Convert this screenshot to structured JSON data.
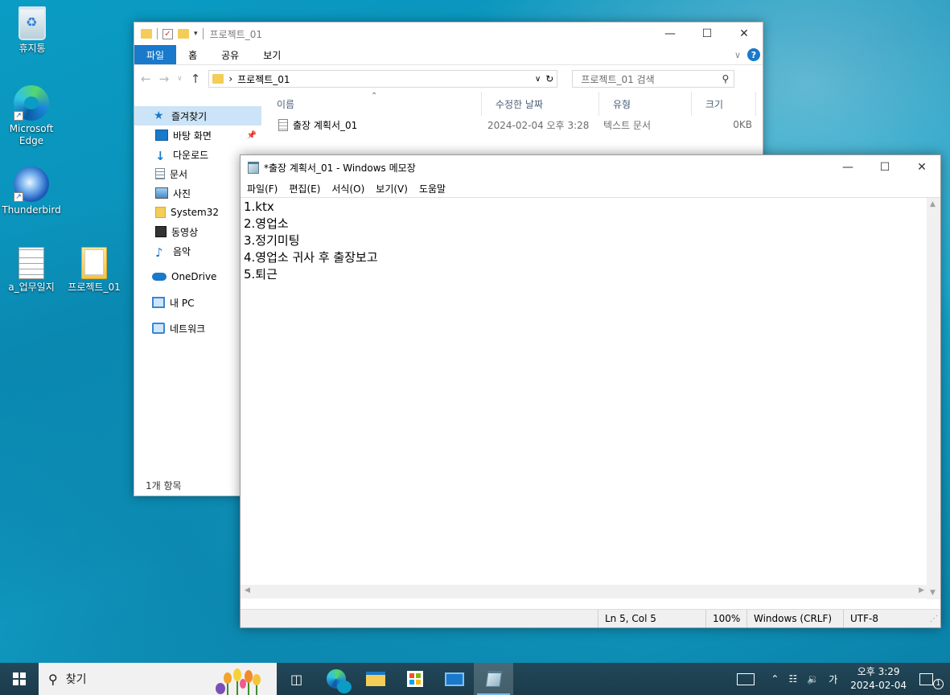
{
  "desktop": {
    "icons": [
      {
        "label": "휴지통"
      },
      {
        "label": "Microsoft Edge"
      },
      {
        "label": "Thunderbird"
      },
      {
        "label": "a_업무일지"
      },
      {
        "label": "프로젝트_01"
      }
    ]
  },
  "explorer": {
    "title": "프로젝트_01",
    "ribbon_tabs": [
      "파일",
      "홈",
      "공유",
      "보기"
    ],
    "address_path": "프로젝트_01",
    "search_placeholder": "프로젝트_01 검색",
    "nav": {
      "quick_access": "즐겨찾기",
      "items": [
        "바탕 화면",
        "다운로드",
        "문서",
        "사진",
        "System32",
        "동영상",
        "음악"
      ],
      "onedrive": "OneDrive",
      "this_pc": "내 PC",
      "network": "네트워크"
    },
    "columns": [
      "이름",
      "수정한 날짜",
      "유형",
      "크기"
    ],
    "files": [
      {
        "name": "출장 계획서_01",
        "modified": "2024-02-04 오후 3:28",
        "type": "텍스트 문서",
        "size": "0KB"
      }
    ],
    "status": "1개 항목"
  },
  "notepad": {
    "title": "*출장 계획서_01 - Windows 메모장",
    "menu": [
      "파일(F)",
      "편집(E)",
      "서식(O)",
      "보기(V)",
      "도움말"
    ],
    "lines": [
      "1.ktx",
      "2.영업소",
      "3.정기미팅",
      "4.영업소 귀사 후 출장보고",
      "5.퇴근"
    ],
    "status": {
      "position": "Ln 5, Col 5",
      "zoom": "100%",
      "line_ending": "Windows (CRLF)",
      "encoding": "UTF-8"
    }
  },
  "taskbar": {
    "search_label": "찾기",
    "ime": "가",
    "time": "오후 3:29",
    "date": "2024-02-04",
    "notification_count": "1"
  }
}
